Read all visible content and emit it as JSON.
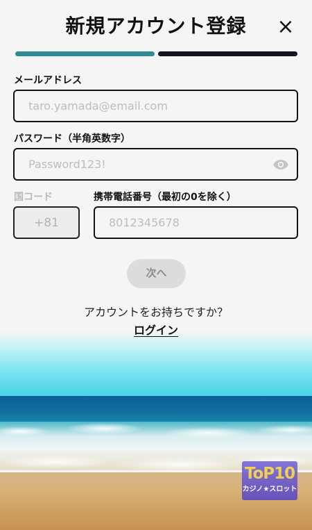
{
  "header": {
    "title": "新規アカウント登録",
    "close_icon": "×"
  },
  "progress": {
    "steps": 2,
    "current_step": 1
  },
  "email": {
    "label": "メールアドレス",
    "placeholder": "taro.yamada@email.com"
  },
  "password": {
    "label": "パスワード（半角英数字）",
    "placeholder": "Password123!",
    "toggle_icon": "eye-icon"
  },
  "country_code": {
    "label": "国コード",
    "value": "+81"
  },
  "phone": {
    "label": "携帯電話番号（最初の0を除く）",
    "placeholder": "8012345678"
  },
  "next_button": {
    "label": "次へ"
  },
  "login_prompt": {
    "question": "アカウントをお持ちですか？",
    "link_label": "ログイン"
  },
  "watermark": {
    "top": "ToP10",
    "bottom": "カジノ★スロット"
  },
  "colors": {
    "progress_active": "#2f8a95",
    "progress_inactive": "#161020",
    "text": "#111111",
    "button_disabled_bg": "#dcdcdc"
  }
}
